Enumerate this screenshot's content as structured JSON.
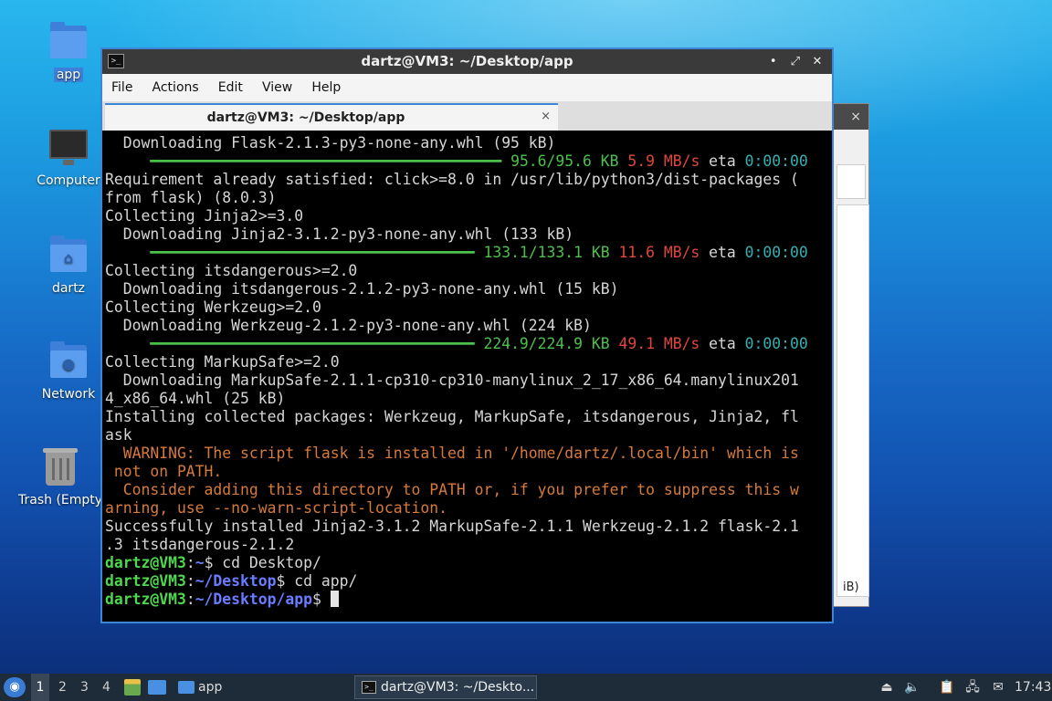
{
  "desktop": {
    "icons": [
      {
        "label": "app"
      },
      {
        "label": "Computer"
      },
      {
        "label": "dartz"
      },
      {
        "label": "Network"
      },
      {
        "label": "Trash (Empty)"
      }
    ]
  },
  "background_window": {
    "close_symbol": "×",
    "visible_text": "iB)"
  },
  "terminal": {
    "title": "dartz@VM3: ~/Desktop/app",
    "controls": {
      "minimize": "•",
      "maximize": "⤢",
      "close": "✕"
    },
    "menu": [
      "File",
      "Actions",
      "Edit",
      "View",
      "Help"
    ],
    "tab": {
      "label": "dartz@VM3: ~/Desktop/app",
      "close": "×"
    },
    "output": {
      "l1": "  Downloading Flask-2.1.3-py3-none-any.whl (95 kB)",
      "l2_bar": "     ━━━━━━━━━━━━━━━━━━━━━━━━━━━━━━━━━━━━━━━",
      "l2_size": " 95.6/95.6 KB",
      "l2_speed": " 5.9 MB/s",
      "l2_eta": " eta",
      "l2_time": " 0:00:00",
      "l3": "Requirement already satisfied: click>=8.0 in /usr/lib/python3/dist-packages (",
      "l4": "from flask) (8.0.3)",
      "l5": "Collecting Jinja2>=3.0",
      "l6": "  Downloading Jinja2-3.1.2-py3-none-any.whl (133 kB)",
      "l7_bar": "     ━━━━━━━━━━━━━━━━━━━━━━━━━━━━━━━━━━━━",
      "l7_size": " 133.1/133.1 KB",
      "l7_speed": " 11.6 MB/s",
      "l7_eta": " eta",
      "l7_time": " 0:00:00",
      "l8": "Collecting itsdangerous>=2.0",
      "l9": "  Downloading itsdangerous-2.1.2-py3-none-any.whl (15 kB)",
      "l10": "Collecting Werkzeug>=2.0",
      "l11": "  Downloading Werkzeug-2.1.2-py3-none-any.whl (224 kB)",
      "l12_bar": "     ━━━━━━━━━━━━━━━━━━━━━━━━━━━━━━━━━━━━",
      "l12_size": " 224.9/224.9 KB",
      "l12_speed": " 49.1 MB/s",
      "l12_eta": " eta",
      "l12_time": " 0:00:00",
      "l13": "Collecting MarkupSafe>=2.0",
      "l14": "  Downloading MarkupSafe-2.1.1-cp310-cp310-manylinux_2_17_x86_64.manylinux201",
      "l15": "4_x86_64.whl (25 kB)",
      "l16": "Installing collected packages: Werkzeug, MarkupSafe, itsdangerous, Jinja2, fl",
      "l17": "ask",
      "l18": "  WARNING: The script flask is installed in '/home/dartz/.local/bin' which is",
      "l19": " not on PATH.",
      "l20": "  Consider adding this directory to PATH or, if you prefer to suppress this w",
      "l21": "arning, use --no-warn-script-location.",
      "l22": "Successfully installed Jinja2-3.1.2 MarkupSafe-2.1.1 Werkzeug-2.1.2 flask-2.1",
      "l23": ".3 itsdangerous-2.1.2",
      "p1_user": "dartz@VM3",
      "p1_colon": ":",
      "p1_path": "~",
      "p1_cmd": "$ cd Desktop/",
      "p2_user": "dartz@VM3",
      "p2_colon": ":",
      "p2_path": "~/Desktop",
      "p2_cmd": "$ cd app/",
      "p3_user": "dartz@VM3",
      "p3_colon": ":",
      "p3_path": "~/Desktop/app",
      "p3_cmd": "$ "
    }
  },
  "taskbar": {
    "workspaces": [
      "1",
      "2",
      "3",
      "4"
    ],
    "folder_button": "app",
    "active_window": "dartz@VM3: ~/Deskto...",
    "clock": "17:43"
  }
}
